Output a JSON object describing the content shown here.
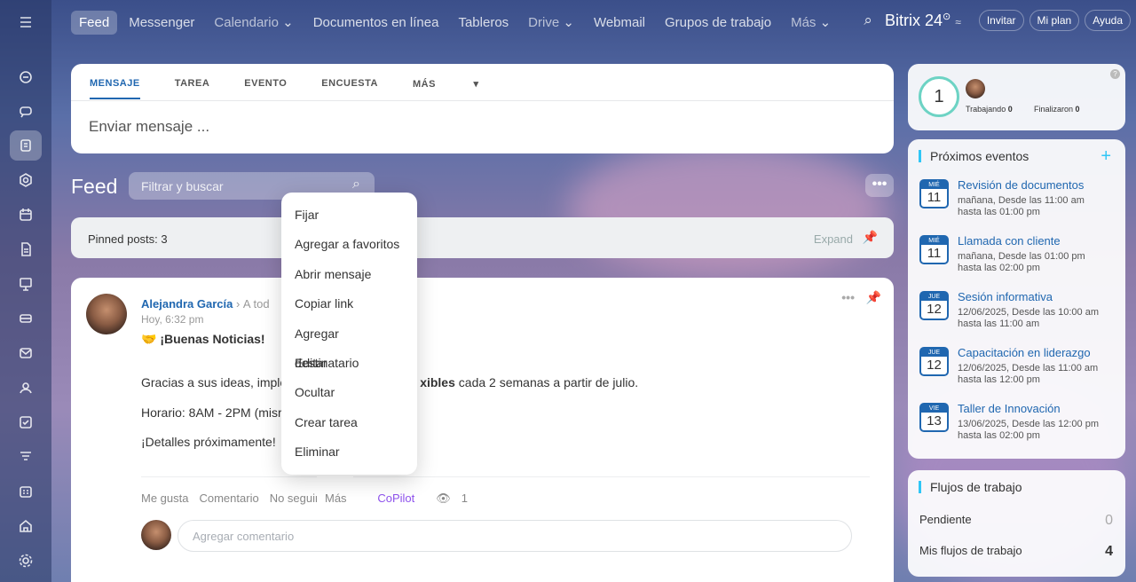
{
  "nav": {
    "items": [
      "Feed",
      "Messenger",
      "Calendario",
      "Documentos en línea",
      "Tableros",
      "Drive",
      "Webmail",
      "Grupos de trabajo",
      "Más"
    ],
    "brand": "Bitrix 24",
    "invite": "Invitar",
    "plan": "Mi plan",
    "help": "Ayuda"
  },
  "composer": {
    "tabs": [
      "MENSAJE",
      "TAREA",
      "EVENTO",
      "ENCUESTA",
      "MÁS"
    ],
    "placeholder": "Enviar mensaje ..."
  },
  "feed": {
    "title": "Feed",
    "filter_placeholder": "Filtrar y buscar",
    "pinned_label": "Pinned posts: 3",
    "expand": "Expand"
  },
  "post": {
    "author": "Alejandra García",
    "recipient": "A tod",
    "time": "Hoy, 6:32 pm",
    "title": "🤝 ¡Buenas Noticias!",
    "line1_a": "Gracias a sus ideas, imple",
    "line1_b": "xibles",
    "line1_c": " cada 2 semanas a partir de julio.",
    "line2": "Horario: 8AM - 2PM (misr",
    "line3": "¡Detalles próximamente!",
    "actions": {
      "like": "Me gusta",
      "comment": "Comentario",
      "unfollow": "No seguir",
      "more": "Más",
      "copilot": "CoPilot",
      "views": "1"
    },
    "comment_placeholder": "Agregar comentario"
  },
  "menu": [
    "Fijar",
    "Agregar a favoritos",
    "Abrir mensaje",
    "Copiar link",
    "Agregar destinatario",
    "Editar",
    "Ocultar",
    "Crear tarea",
    "Eliminar"
  ],
  "timeman": {
    "count": "1",
    "working_label": "Trabajando",
    "working": "0",
    "finished_label": "Finalizaron",
    "finished": "0"
  },
  "events": {
    "title": "Próximos eventos",
    "items": [
      {
        "dw": "MIÉ",
        "dd": "11",
        "title": "Revisión de documentos",
        "l1": "mañana, Desde las 11:00 am",
        "l2": "hasta las 01:00 pm"
      },
      {
        "dw": "MIÉ",
        "dd": "11",
        "title": "Llamada con cliente",
        "l1": "mañana, Desde las 01:00 pm",
        "l2": "hasta las 02:00 pm"
      },
      {
        "dw": "JUE",
        "dd": "12",
        "title": "Sesión informativa",
        "l1": "12/06/2025, Desde las 10:00 am",
        "l2": "hasta las 11:00 am"
      },
      {
        "dw": "JUE",
        "dd": "12",
        "title": "Capacitación en liderazgo",
        "l1": "12/06/2025, Desde las 11:00 am",
        "l2": "hasta las 12:00 pm"
      },
      {
        "dw": "VIE",
        "dd": "13",
        "title": "Taller de Innovación",
        "l1": "13/06/2025, Desde las 12:00 pm",
        "l2": "hasta las 02:00 pm"
      }
    ]
  },
  "flows": {
    "title": "Flujos de trabajo",
    "pending_label": "Pendiente",
    "pending": "0",
    "mine_label": "Mis flujos de trabajo",
    "mine": "4"
  }
}
